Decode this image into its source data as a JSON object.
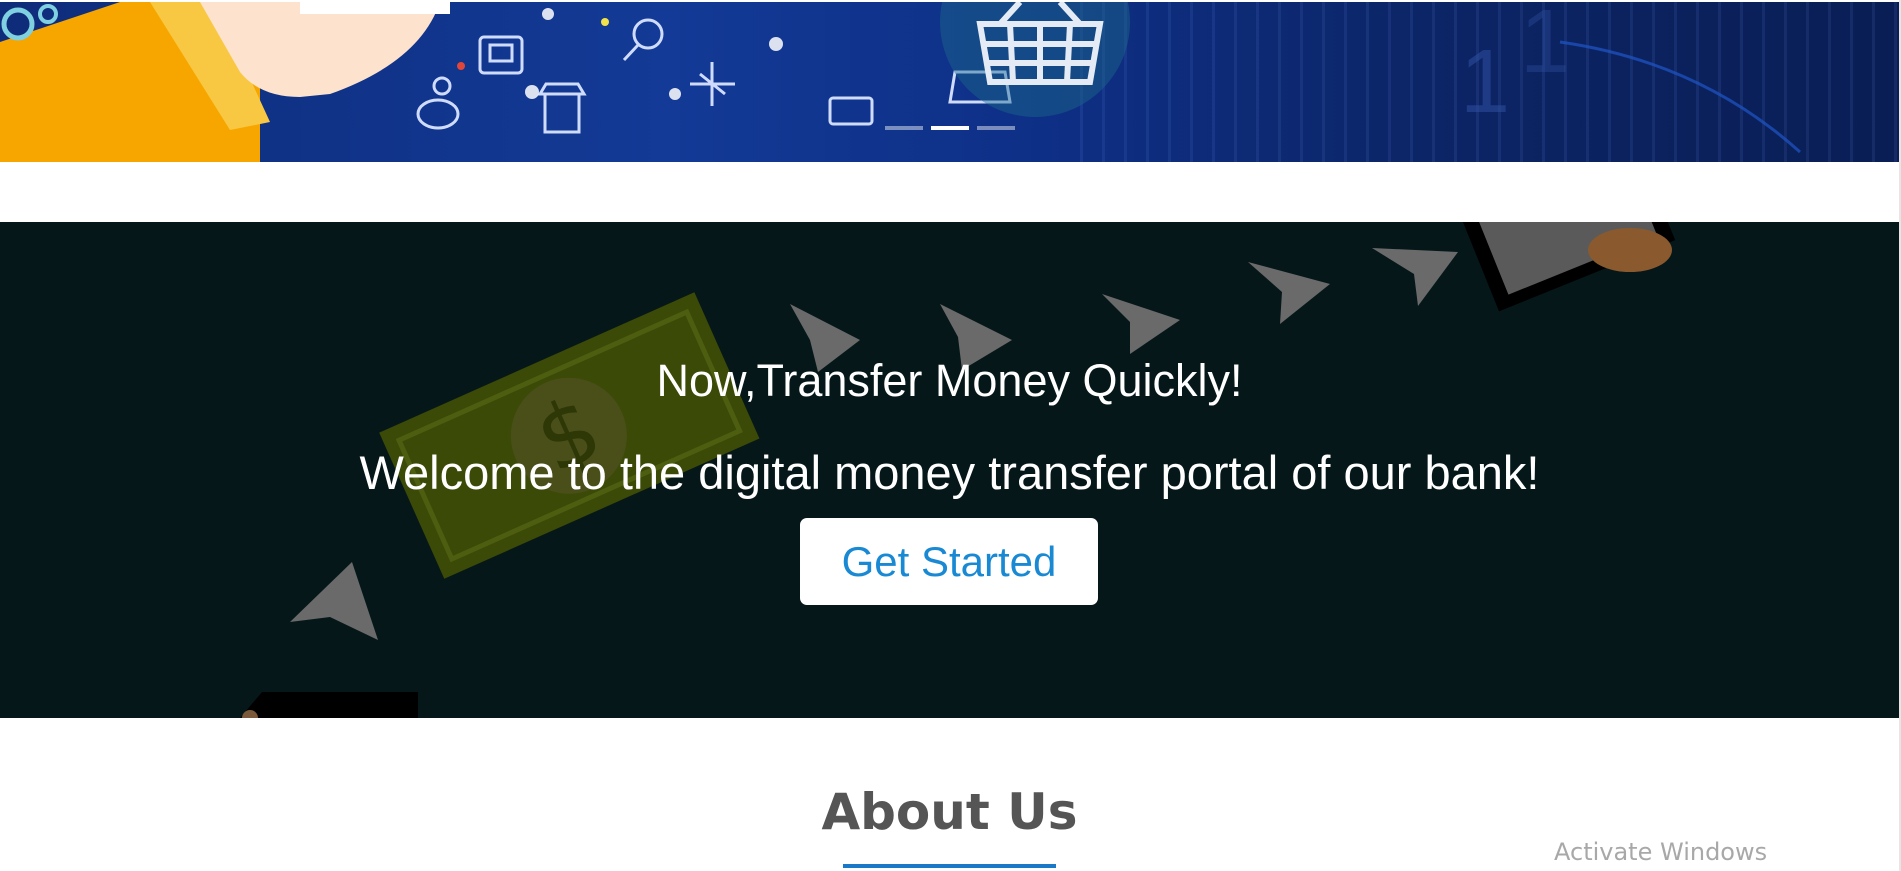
{
  "carousel": {
    "indicators": [
      {
        "label": "slide-1",
        "active": false
      },
      {
        "label": "slide-2",
        "active": true
      },
      {
        "label": "slide-3",
        "active": false
      }
    ]
  },
  "transfer": {
    "title": "Now,Transfer Money Quickly!",
    "subtitle": "Welcome to the digital money transfer portal of our bank!",
    "cta_label": "Get Started"
  },
  "about": {
    "title": "About Us"
  },
  "os_watermark": "Activate Windows",
  "colors": {
    "banner_blue": "#123a96",
    "section_dark": "#06171a",
    "accent_blue": "#1a89d4",
    "heading_gray": "#555555"
  }
}
